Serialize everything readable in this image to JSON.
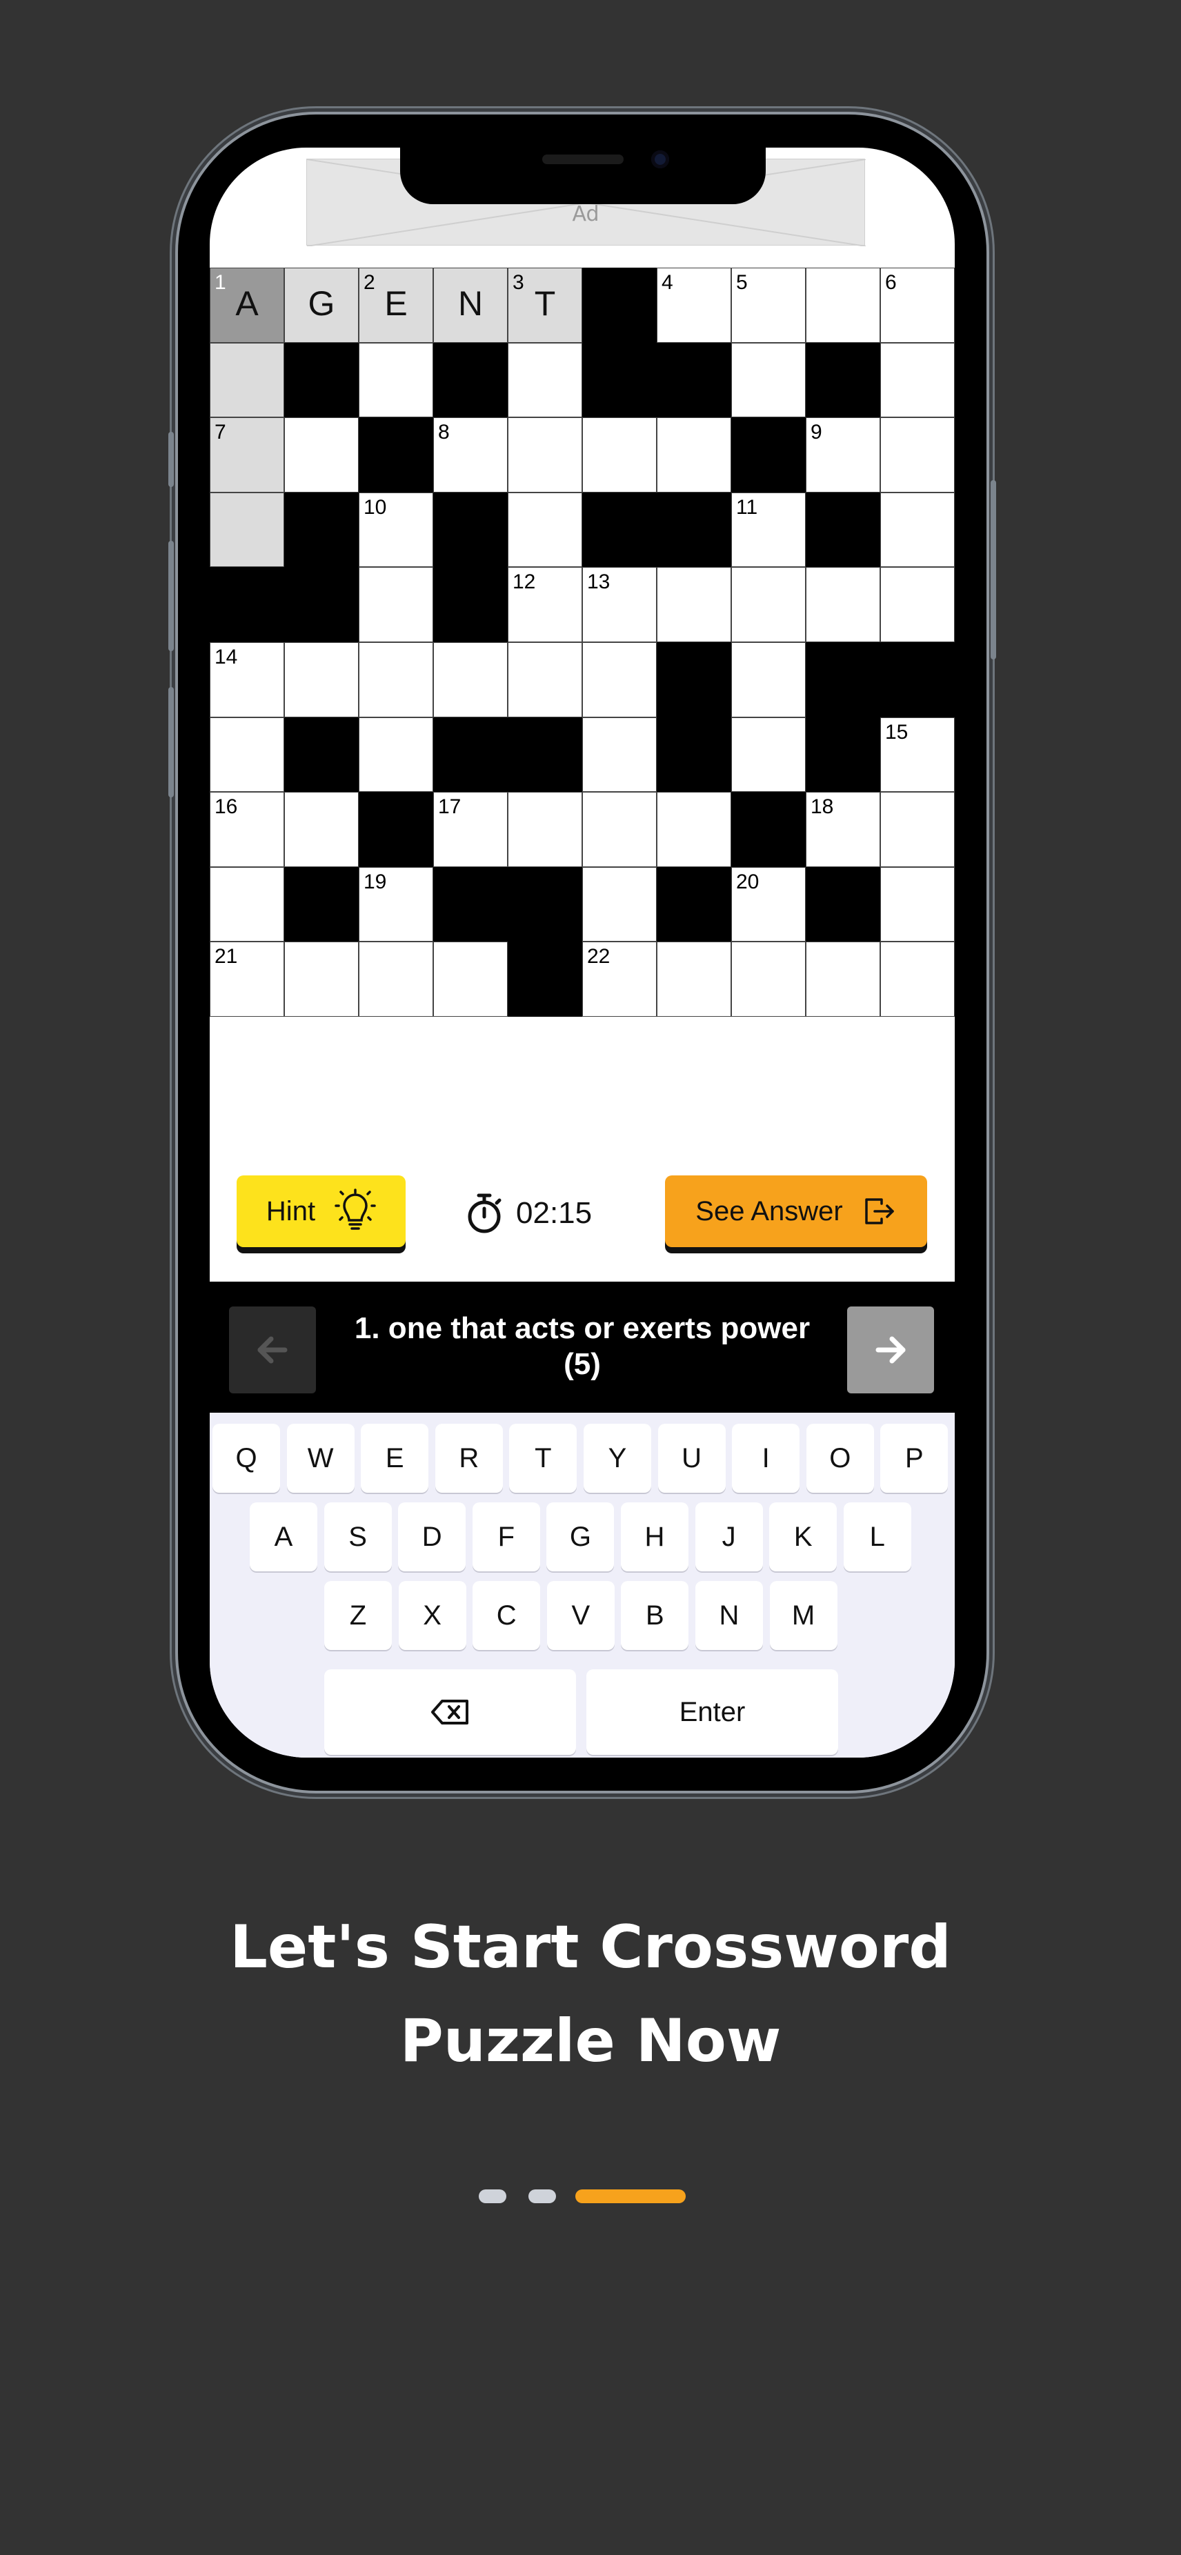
{
  "ad": {
    "label": "Ad"
  },
  "grid": {
    "rows": [
      [
        "A1",
        "G",
        "E2",
        "N",
        "T3",
        "#",
        "4",
        "5",
        "",
        "6"
      ],
      [
        "",
        "#",
        "",
        "#",
        "",
        "#",
        "#",
        "",
        "#",
        ""
      ],
      [
        "7",
        "",
        "#",
        "8",
        "",
        "",
        "",
        "#",
        "9",
        ""
      ],
      [
        "",
        "#",
        "10",
        "#",
        "",
        "#",
        "#",
        "11",
        "#",
        ""
      ],
      [
        "#",
        "#",
        "",
        "#",
        "12",
        "13",
        "",
        "",
        "",
        ""
      ],
      [
        "14",
        "",
        "",
        "",
        "",
        "",
        "#",
        "",
        "#",
        "#"
      ],
      [
        "",
        "#",
        "",
        "#",
        "#",
        "",
        "#",
        "",
        "#",
        "15"
      ],
      [
        "16",
        "",
        "#",
        "17",
        "",
        "",
        "",
        "#",
        "18",
        ""
      ],
      [
        "",
        "#",
        "19",
        "#",
        "#",
        "",
        "#",
        "20",
        "#",
        ""
      ],
      [
        "21",
        "",
        "",
        "",
        "#",
        "22",
        "",
        "",
        "",
        ""
      ]
    ],
    "active_word": {
      "number": "1",
      "cells": [
        "0,0",
        "0,1",
        "0,2",
        "0,3",
        "0,4"
      ]
    },
    "active_down": {
      "cells": [
        "1,0",
        "2,0",
        "3,0"
      ]
    }
  },
  "actions": {
    "hint_label": "Hint",
    "hint_icon": "lightbulb-icon",
    "timer_value": "02:15",
    "timer_icon": "stopwatch-icon",
    "answer_label": "See Answer",
    "answer_icon": "exit-icon"
  },
  "clue": {
    "text": "1. one that acts or exerts power (5)",
    "prev_icon": "arrow-left-icon",
    "next_icon": "arrow-right-icon"
  },
  "keyboard": {
    "row1": [
      "Q",
      "W",
      "E",
      "R",
      "T",
      "Y",
      "U",
      "I",
      "O",
      "P"
    ],
    "row2": [
      "A",
      "S",
      "D",
      "F",
      "G",
      "H",
      "J",
      "K",
      "L"
    ],
    "row3": [
      "Z",
      "X",
      "C",
      "V",
      "B",
      "N",
      "M"
    ],
    "backspace_icon": "backspace-icon",
    "enter_label": "Enter"
  },
  "caption": {
    "line1": "Let's Start Crossword",
    "line2": "Puzzle Now"
  },
  "pagination": {
    "total": 3,
    "active": 3,
    "colors": {
      "inactive": "#cfd3da",
      "active": "#f7a21c"
    }
  },
  "colors": {
    "background": "#333333",
    "hint": "#fde21c",
    "answer": "#f7a21c",
    "highlight": "#dcdcdc",
    "active_cell": "#999999"
  }
}
